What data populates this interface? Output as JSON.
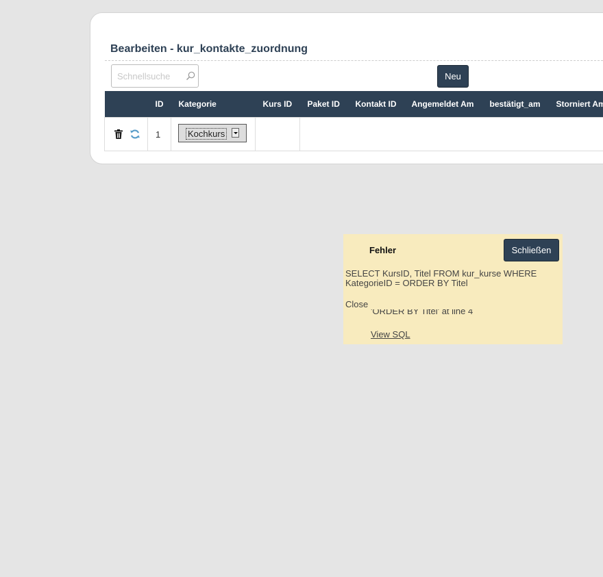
{
  "panel": {
    "title": "Bearbeiten - kur_kontakte_zuordnung",
    "search": {
      "placeholder": "Schnellsuche",
      "value": ""
    },
    "new_button": "Neu"
  },
  "table": {
    "columns": [
      "",
      "ID",
      "Kategorie",
      "Kurs ID",
      "Paket ID",
      "Kontakt ID",
      "Angemeldet Am",
      "bestätigt_am",
      "Storniert Am"
    ],
    "rows": [
      {
        "id": "1",
        "kategorie": "Kochkurs"
      }
    ]
  },
  "error": {
    "title": "Fehler",
    "close_button": "Schließen",
    "sql_text": "SELECT KursID, Titel FROM kur_kurse WHERE KategorieID = ORDER BY Titel",
    "close_text": "Close",
    "message": "'ORDER BY Titel' at line 4",
    "view_sql_link": "View SQL"
  },
  "colors": {
    "accent": "#2e4155",
    "error_background": "#f8ebbe",
    "page_background": "#e5e5e5"
  },
  "icons": [
    "search-icon",
    "trash-icon",
    "refresh-icon",
    "chevron-down-icon"
  ]
}
